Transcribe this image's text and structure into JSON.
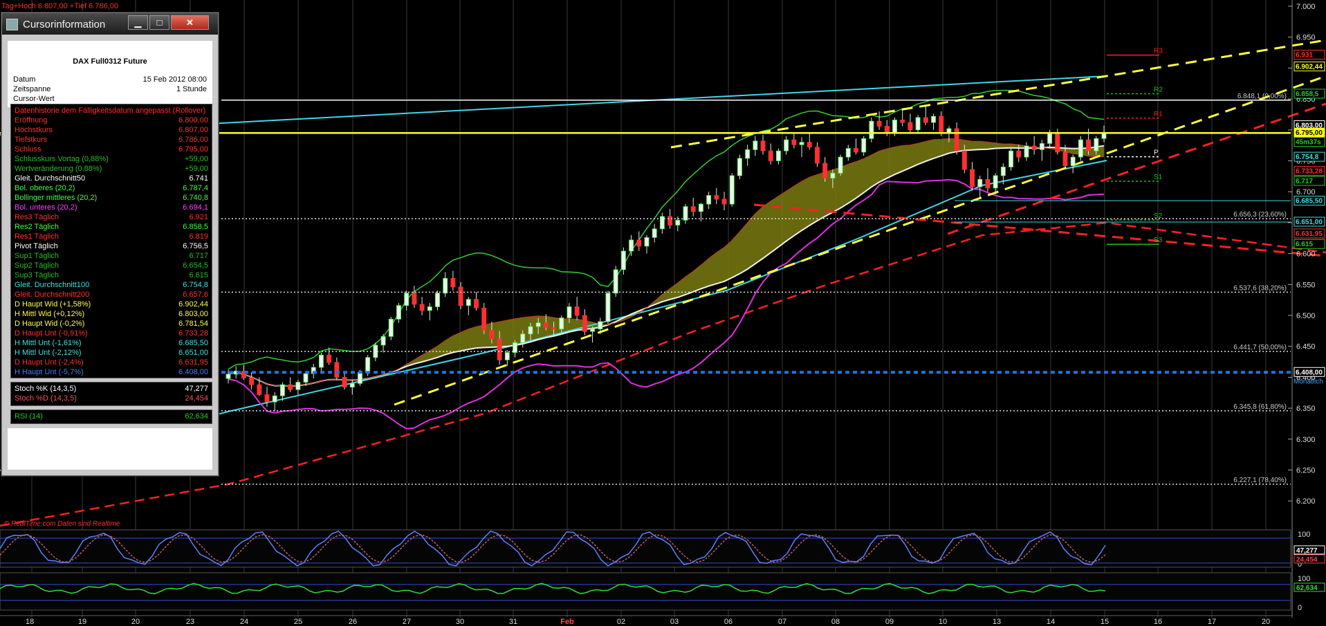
{
  "header": {
    "text": "Tag+Hoch 6.807,00 +Tief 6.786,00"
  },
  "watermark": "© RealTime.com   Daten sind Realtime",
  "chart_data": {
    "type": "candlestick",
    "instrument": "DAX Full0312 Future",
    "ylim": [
      6160,
      7010
    ],
    "y_ticks": [
      {
        "v": 7000,
        "label": "7.000"
      },
      {
        "v": 6950,
        "label": "6.950"
      },
      {
        "v": 6900,
        "label": "6.900"
      },
      {
        "v": 6850,
        "label": "6.850"
      },
      {
        "v": 6800,
        "label": "6.800"
      },
      {
        "v": 6750,
        "label": "6.750"
      },
      {
        "v": 6700,
        "label": "6.700"
      },
      {
        "v": 6650,
        "label": "6.650"
      },
      {
        "v": 6600,
        "label": "6.600"
      },
      {
        "v": 6550,
        "label": "6.550"
      },
      {
        "v": 6500,
        "label": "6.500"
      },
      {
        "v": 6450,
        "label": "6.450"
      },
      {
        "v": 6400,
        "label": "6.400"
      },
      {
        "v": 6350,
        "label": "6.350"
      },
      {
        "v": 6300,
        "label": "6.300"
      },
      {
        "v": 6250,
        "label": "6.250"
      },
      {
        "v": 6200,
        "label": "6.200"
      }
    ],
    "x_ticks": [
      "18",
      "19",
      "20",
      "23",
      "24",
      "25",
      "26",
      "27",
      "30",
      "31",
      "Feb",
      "02",
      "03",
      "06",
      "07",
      "08",
      "09",
      "10",
      "13",
      "14",
      "15",
      "16",
      "17",
      "20"
    ],
    "fib_levels": [
      {
        "v": 6848.1,
        "label": "6.848,1 (0,00%)"
      },
      {
        "v": 6656.3,
        "label": "6.656,3 (23,60%)"
      },
      {
        "v": 6537.6,
        "label": "6.537,6 (38,20%)"
      },
      {
        "v": 6441.7,
        "label": "6.441,7 (50,00%)"
      },
      {
        "v": 6345.8,
        "label": "6.345,8 (61,80%)"
      },
      {
        "v": 6227.1,
        "label": "6.227,1 (78,40%)"
      }
    ],
    "pivots": [
      {
        "name": "R3",
        "v": 6921,
        "color": "#ff2020"
      },
      {
        "name": "R2",
        "v": 6858.5,
        "color": "#20c020"
      },
      {
        "name": "R1",
        "v": 6819,
        "color": "#ff2020"
      },
      {
        "name": "P",
        "v": 6756.5,
        "color": "#ffffff"
      },
      {
        "name": "S1",
        "v": 6717,
        "color": "#20c020"
      },
      {
        "name": "S2",
        "v": 6654.5,
        "color": "#20c020"
      },
      {
        "name": "S3",
        "v": 6615,
        "color": "#20c020"
      }
    ],
    "monthly_line": {
      "v": 6408,
      "label": "Monatlich"
    },
    "price_tags": [
      {
        "label": "6.931",
        "v": 6921,
        "bg": "#000",
        "fg": "#ff3030",
        "border": "#ff3030"
      },
      {
        "label": "6.902,44",
        "v": 6902,
        "bg": "#000",
        "fg": "#ffff40",
        "border": "#ffff40"
      },
      {
        "label": "6.858,5",
        "v": 6858,
        "bg": "#000",
        "fg": "#20d020",
        "border": "#20d020"
      },
      {
        "label": "6.803,00",
        "v": 6807,
        "bg": "#000",
        "fg": "#ffffff",
        "border": "#ffffff"
      },
      {
        "label": "6.795,00",
        "v": 6795,
        "bg": "#ffff00",
        "fg": "#000",
        "border": "#ffff00"
      },
      {
        "label": "45m37s",
        "v": 6780,
        "bg": "#000",
        "fg": "#20d020",
        "border": "#20d020"
      },
      {
        "label": "6.754,8",
        "v": 6756,
        "bg": "#000",
        "fg": "#40e0e0",
        "border": "#40e0e0"
      },
      {
        "label": "6.733,28",
        "v": 6733,
        "bg": "#000",
        "fg": "#ff3030",
        "border": "#ff3030"
      },
      {
        "label": "6.717",
        "v": 6717,
        "bg": "#000",
        "fg": "#20d020",
        "border": "#20d020"
      },
      {
        "label": "6.685,50",
        "v": 6685,
        "bg": "#000",
        "fg": "#40e0e0",
        "border": "#40e0e0"
      },
      {
        "label": "6.651,00",
        "v": 6651,
        "bg": "#000",
        "fg": "#40e0e0",
        "border": "#40e0e0"
      },
      {
        "label": "6.631,95",
        "v": 6632,
        "bg": "#000",
        "fg": "#ff3030",
        "border": "#ff3030"
      },
      {
        "label": "6.615",
        "v": 6615,
        "bg": "#000",
        "fg": "#20d020",
        "border": "#20d020"
      },
      {
        "label": "6.408,00",
        "v": 6408,
        "bg": "#000",
        "fg": "#ffffff",
        "border": "#ffffff"
      }
    ],
    "candles": [
      [
        6398,
        6412,
        6390,
        6405
      ],
      [
        6405,
        6418,
        6398,
        6410
      ],
      [
        6410,
        6420,
        6396,
        6399
      ],
      [
        6399,
        6408,
        6380,
        6388
      ],
      [
        6388,
        6400,
        6370,
        6372
      ],
      [
        6372,
        6385,
        6352,
        6360
      ],
      [
        6360,
        6376,
        6345,
        6370
      ],
      [
        6370,
        6392,
        6362,
        6388
      ],
      [
        6388,
        6400,
        6376,
        6380
      ],
      [
        6380,
        6396,
        6372,
        6392
      ],
      [
        6392,
        6410,
        6386,
        6406
      ],
      [
        6406,
        6422,
        6398,
        6416
      ],
      [
        6416,
        6440,
        6408,
        6436
      ],
      [
        6436,
        6448,
        6420,
        6424
      ],
      [
        6424,
        6432,
        6396,
        6400
      ],
      [
        6400,
        6410,
        6380,
        6384
      ],
      [
        6384,
        6396,
        6372,
        6390
      ],
      [
        6390,
        6412,
        6386,
        6408
      ],
      [
        6408,
        6436,
        6402,
        6432
      ],
      [
        6432,
        6456,
        6426,
        6452
      ],
      [
        6452,
        6470,
        6440,
        6466
      ],
      [
        6466,
        6498,
        6460,
        6494
      ],
      [
        6494,
        6520,
        6488,
        6516
      ],
      [
        6516,
        6540,
        6508,
        6536
      ],
      [
        6536,
        6548,
        6512,
        6518
      ],
      [
        6518,
        6530,
        6500,
        6508
      ],
      [
        6508,
        6520,
        6492,
        6514
      ],
      [
        6514,
        6540,
        6508,
        6536
      ],
      [
        6536,
        6570,
        6530,
        6560
      ],
      [
        6560,
        6572,
        6540,
        6546
      ],
      [
        6546,
        6554,
        6510,
        6516
      ],
      [
        6516,
        6530,
        6500,
        6526
      ],
      [
        6526,
        6538,
        6508,
        6512
      ],
      [
        6512,
        6520,
        6470,
        6476
      ],
      [
        6476,
        6490,
        6455,
        6462
      ],
      [
        6462,
        6475,
        6420,
        6428
      ],
      [
        6428,
        6444,
        6418,
        6440
      ],
      [
        6440,
        6460,
        6432,
        6456
      ],
      [
        6456,
        6476,
        6448,
        6470
      ],
      [
        6470,
        6488,
        6460,
        6482
      ],
      [
        6482,
        6496,
        6470,
        6488
      ],
      [
        6488,
        6502,
        6476,
        6480
      ],
      [
        6480,
        6490,
        6466,
        6478
      ],
      [
        6478,
        6500,
        6472,
        6496
      ],
      [
        6496,
        6520,
        6488,
        6514
      ],
      [
        6514,
        6530,
        6492,
        6500
      ],
      [
        6500,
        6510,
        6468,
        6474
      ],
      [
        6474,
        6482,
        6456,
        6478
      ],
      [
        6478,
        6496,
        6470,
        6490
      ],
      [
        6490,
        6540,
        6486,
        6536
      ],
      [
        6536,
        6580,
        6530,
        6574
      ],
      [
        6574,
        6610,
        6566,
        6604
      ],
      [
        6604,
        6630,
        6596,
        6622
      ],
      [
        6622,
        6636,
        6604,
        6612
      ],
      [
        6612,
        6630,
        6600,
        6626
      ],
      [
        6626,
        6648,
        6618,
        6640
      ],
      [
        6640,
        6666,
        6632,
        6660
      ],
      [
        6660,
        6672,
        6640,
        6646
      ],
      [
        6646,
        6660,
        6636,
        6654
      ],
      [
        6654,
        6680,
        6648,
        6676
      ],
      [
        6676,
        6690,
        6660,
        6668
      ],
      [
        6668,
        6682,
        6652,
        6680
      ],
      [
        6680,
        6700,
        6672,
        6694
      ],
      [
        6694,
        6706,
        6680,
        6688
      ],
      [
        6688,
        6700,
        6670,
        6680
      ],
      [
        6680,
        6730,
        6676,
        6726
      ],
      [
        6726,
        6760,
        6720,
        6754
      ],
      [
        6754,
        6776,
        6742,
        6768
      ],
      [
        6768,
        6790,
        6758,
        6782
      ],
      [
        6782,
        6792,
        6760,
        6766
      ],
      [
        6766,
        6778,
        6744,
        6750
      ],
      [
        6750,
        6770,
        6744,
        6766
      ],
      [
        6766,
        6790,
        6760,
        6784
      ],
      [
        6784,
        6796,
        6770,
        6776
      ],
      [
        6776,
        6788,
        6756,
        6780
      ],
      [
        6780,
        6794,
        6768,
        6772
      ],
      [
        6772,
        6780,
        6740,
        6746
      ],
      [
        6746,
        6756,
        6716,
        6722
      ],
      [
        6722,
        6736,
        6706,
        6730
      ],
      [
        6730,
        6760,
        6726,
        6756
      ],
      [
        6756,
        6776,
        6750,
        6770
      ],
      [
        6770,
        6786,
        6760,
        6764
      ],
      [
        6764,
        6790,
        6758,
        6786
      ],
      [
        6786,
        6820,
        6780,
        6814
      ],
      [
        6814,
        6830,
        6800,
        6806
      ],
      [
        6806,
        6816,
        6790,
        6796
      ],
      [
        6796,
        6820,
        6790,
        6816
      ],
      [
        6816,
        6834,
        6806,
        6812
      ],
      [
        6812,
        6826,
        6796,
        6800
      ],
      [
        6800,
        6824,
        6796,
        6820
      ],
      [
        6820,
        6840,
        6808,
        6812
      ],
      [
        6812,
        6826,
        6800,
        6822
      ],
      [
        6822,
        6830,
        6790,
        6794
      ],
      [
        6794,
        6806,
        6780,
        6802
      ],
      [
        6802,
        6812,
        6760,
        6766
      ],
      [
        6766,
        6776,
        6730,
        6736
      ],
      [
        6736,
        6748,
        6702,
        6708
      ],
      [
        6708,
        6726,
        6688,
        6720
      ],
      [
        6720,
        6738,
        6700,
        6706
      ],
      [
        6706,
        6730,
        6696,
        6726
      ],
      [
        6726,
        6746,
        6712,
        6740
      ],
      [
        6740,
        6770,
        6734,
        6766
      ],
      [
        6766,
        6776,
        6748,
        6756
      ],
      [
        6756,
        6780,
        6750,
        6774
      ],
      [
        6774,
        6790,
        6760,
        6768
      ],
      [
        6768,
        6784,
        6750,
        6778
      ],
      [
        6778,
        6800,
        6770,
        6794
      ],
      [
        6794,
        6802,
        6760,
        6764
      ],
      [
        6764,
        6776,
        6736,
        6742
      ],
      [
        6742,
        6760,
        6730,
        6756
      ],
      [
        6756,
        6790,
        6750,
        6784
      ],
      [
        6784,
        6802,
        6760,
        6766
      ],
      [
        6766,
        6790,
        6760,
        6786
      ],
      [
        6786,
        6807,
        6780,
        6795
      ]
    ]
  },
  "cursor_info": {
    "window_title": "Cursorinformation",
    "btn_min": "▁",
    "btn_max": "□",
    "btn_close": "✕",
    "instrument": "DAX Full0312 Future",
    "datum_label": "Datum",
    "datum_value": "15 Feb 2012 08:00",
    "zeitspanne_label": "Zeitspanne",
    "zeitspanne_value": "1 Stunde",
    "cursorwert_label": "Cursor-Wert",
    "cursorwert_value": "",
    "rows": [
      {
        "label": "Datenhistorie dem Fälligkeitsdatum angepasst (Rollover)",
        "value": "",
        "color": "#ff3030"
      },
      {
        "label": "Eröffnung",
        "value": "6.800,00",
        "color": "#ff3030"
      },
      {
        "label": "Höchstkurs",
        "value": "6.807,00",
        "color": "#ff3030"
      },
      {
        "label": "Tiefstkurs",
        "value": "6.786,00",
        "color": "#ff3030"
      },
      {
        "label": "Schluss",
        "value": "6.795,00",
        "color": "#ff3030"
      },
      {
        "label": "Schlusskurs Vortag (0,88%)",
        "value": "+59,00",
        "color": "#20c020"
      },
      {
        "label": "Wertveränderung (0,88%)",
        "value": "+59,00",
        "color": "#20c020"
      },
      {
        "label": "Gleit. Durchschnitt50",
        "value": "6.741",
        "color": "#ffffff"
      },
      {
        "label": "Bol. oberes (20,2)",
        "value": "6.787,4",
        "color": "#40ff40"
      },
      {
        "label": "Bollinger mittleres (20,2)",
        "value": "6.740,8",
        "color": "#40ff40"
      },
      {
        "label": "Bol. unteres (20,2)",
        "value": "6.694,1",
        "color": "#ff40ff"
      },
      {
        "label": "Res3 Täglich",
        "value": "6.921",
        "color": "#ff3030"
      },
      {
        "label": "Res2 Täglich",
        "value": "6.858,5",
        "color": "#40ff40"
      },
      {
        "label": "Res1 Täglich",
        "value": "6.819",
        "color": "#ff3030"
      },
      {
        "label": "Pivot Täglich",
        "value": "6.756,5",
        "color": "#ffffff"
      },
      {
        "label": "Sup1 Täglich",
        "value": "6.717",
        "color": "#20c020"
      },
      {
        "label": "Sup2 Täglich",
        "value": "6.654,5",
        "color": "#20c020"
      },
      {
        "label": "Sup3 Täglich",
        "value": "6.615",
        "color": "#20c020"
      },
      {
        "label": "Gleit. Durchschnitt100",
        "value": "6.754,8",
        "color": "#40e0e0"
      },
      {
        "label": "Gleit. Durchschnitt200",
        "value": "6.657,6",
        "color": "#ff3030"
      },
      {
        "label": "D Haupt Wid (+1,58%)",
        "value": "6.902,44",
        "color": "#ffff40"
      },
      {
        "label": "H Mittl Wid (+0,12%)",
        "value": "6.803,00",
        "color": "#ffff40"
      },
      {
        "label": "D Haupt Wid (-0,2%)",
        "value": "6.781,54",
        "color": "#ffff40"
      },
      {
        "label": "D Haupt Unt (-0,91%)",
        "value": "6.733,28",
        "color": "#ff3030"
      },
      {
        "label": "H Mittl Unt (-1,61%)",
        "value": "6.685,50",
        "color": "#40e0e0"
      },
      {
        "label": "H Mittl Unt (-2,12%)",
        "value": "6.651,00",
        "color": "#40e0e0"
      },
      {
        "label": "D Haupt Unt (-2,4%)",
        "value": "6.631,95",
        "color": "#ff3030"
      },
      {
        "label": "H Haupt Unt (-5,7%)",
        "value": "6.408,00",
        "color": "#4080ff"
      }
    ],
    "stoch_k_label": "Stoch %K (14,3,5)",
    "stoch_k_value": "47,277",
    "stoch_d_label": "Stoch %D (14,3,5)",
    "stoch_d_value": "24,454",
    "rsi_label": "RSI (14)",
    "rsi_value": "62,634"
  },
  "stoch_panel": {
    "labels": [
      "100",
      "0"
    ],
    "k_tag": "47,277",
    "d_tag": "24,454"
  },
  "rsi_panel": {
    "labels": [
      "100",
      "0"
    ],
    "tag": "62,634"
  }
}
